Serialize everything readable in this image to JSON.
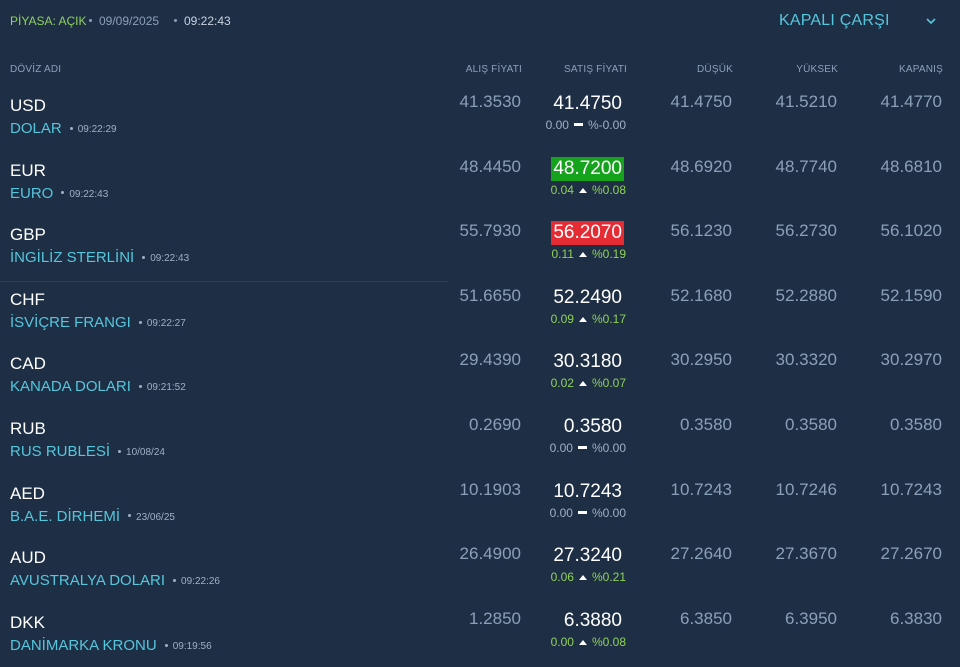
{
  "topbar": {
    "market_status": "PİYASA: AÇIK",
    "date": "09/09/2025",
    "time": "09:22:43",
    "market_select": "KAPALI ÇARŞI"
  },
  "columns": {
    "name": "DÖVİZ ADI",
    "buy": "ALIŞ FİYATI",
    "sell": "SATIŞ FİYATI",
    "low": "DÜŞÜK",
    "high": "YÜKSEK",
    "close": "KAPANIŞ"
  },
  "rows": [
    {
      "code": "USD",
      "name": "DOLAR",
      "time": "09:22:29",
      "buy": "41.3530",
      "sell": "41.4750",
      "change": "0.00",
      "change_pct": "%-0.00",
      "direction": "flat",
      "highlight": "",
      "low": "41.4750",
      "high": "41.5210",
      "close": "41.4770"
    },
    {
      "code": "EUR",
      "name": "EURO",
      "time": "09:22:43",
      "buy": "48.4450",
      "sell": "48.7200",
      "change": "0.04",
      "change_pct": "%0.08",
      "direction": "up",
      "highlight": "up",
      "low": "48.6920",
      "high": "48.7740",
      "close": "48.6810"
    },
    {
      "code": "GBP",
      "name": "İNGİLİZ STERLİNİ",
      "time": "09:22:43",
      "buy": "55.7930",
      "sell": "56.2070",
      "change": "0.11",
      "change_pct": "%0.19",
      "direction": "up",
      "highlight": "down",
      "low": "56.1230",
      "high": "56.2730",
      "close": "56.1020"
    },
    {
      "code": "CHF",
      "name": "İSVİÇRE FRANGI",
      "time": "09:22:27",
      "buy": "51.6650",
      "sell": "52.2490",
      "change": "0.09",
      "change_pct": "%0.17",
      "direction": "up",
      "highlight": "",
      "low": "52.1680",
      "high": "52.2880",
      "close": "52.1590"
    },
    {
      "code": "CAD",
      "name": "KANADA DOLARI",
      "time": "09:21:52",
      "buy": "29.4390",
      "sell": "30.3180",
      "change": "0.02",
      "change_pct": "%0.07",
      "direction": "up",
      "highlight": "",
      "low": "30.2950",
      "high": "30.3320",
      "close": "30.2970"
    },
    {
      "code": "RUB",
      "name": "RUS RUBLESİ",
      "time": "10/08/24",
      "buy": "0.2690",
      "sell": "0.3580",
      "change": "0.00",
      "change_pct": "%0.00",
      "direction": "flat",
      "highlight": "",
      "low": "0.3580",
      "high": "0.3580",
      "close": "0.3580"
    },
    {
      "code": "AED",
      "name": "B.A.E. DİRHEMİ",
      "time": "23/06/25",
      "buy": "10.1903",
      "sell": "10.7243",
      "change": "0.00",
      "change_pct": "%0.00",
      "direction": "flat",
      "highlight": "",
      "low": "10.7243",
      "high": "10.7246",
      "close": "10.7243"
    },
    {
      "code": "AUD",
      "name": "AVUSTRALYA DOLARI",
      "time": "09:22:26",
      "buy": "26.4900",
      "sell": "27.3240",
      "change": "0.06",
      "change_pct": "%0.21",
      "direction": "up",
      "highlight": "",
      "low": "27.2640",
      "high": "27.3670",
      "close": "27.2670"
    },
    {
      "code": "DKK",
      "name": "DANİMARKA KRONU",
      "time": "09:19:56",
      "buy": "1.2850",
      "sell": "6.3880",
      "change": "0.00",
      "change_pct": "%0.08",
      "direction": "up",
      "highlight": "",
      "low": "6.3850",
      "high": "6.3950",
      "close": "6.3830"
    }
  ],
  "colors": {
    "background": "#1e2f45",
    "accent": "#55c6dc",
    "positive": "#8fd15a",
    "up_highlight": "#15a31d",
    "down_highlight": "#e52c34",
    "muted": "#8aa0b8"
  },
  "icons": {
    "market_select": "chevron-down-icon",
    "change_up": "caret-up-icon",
    "change_flat": "flat-dash-icon"
  }
}
